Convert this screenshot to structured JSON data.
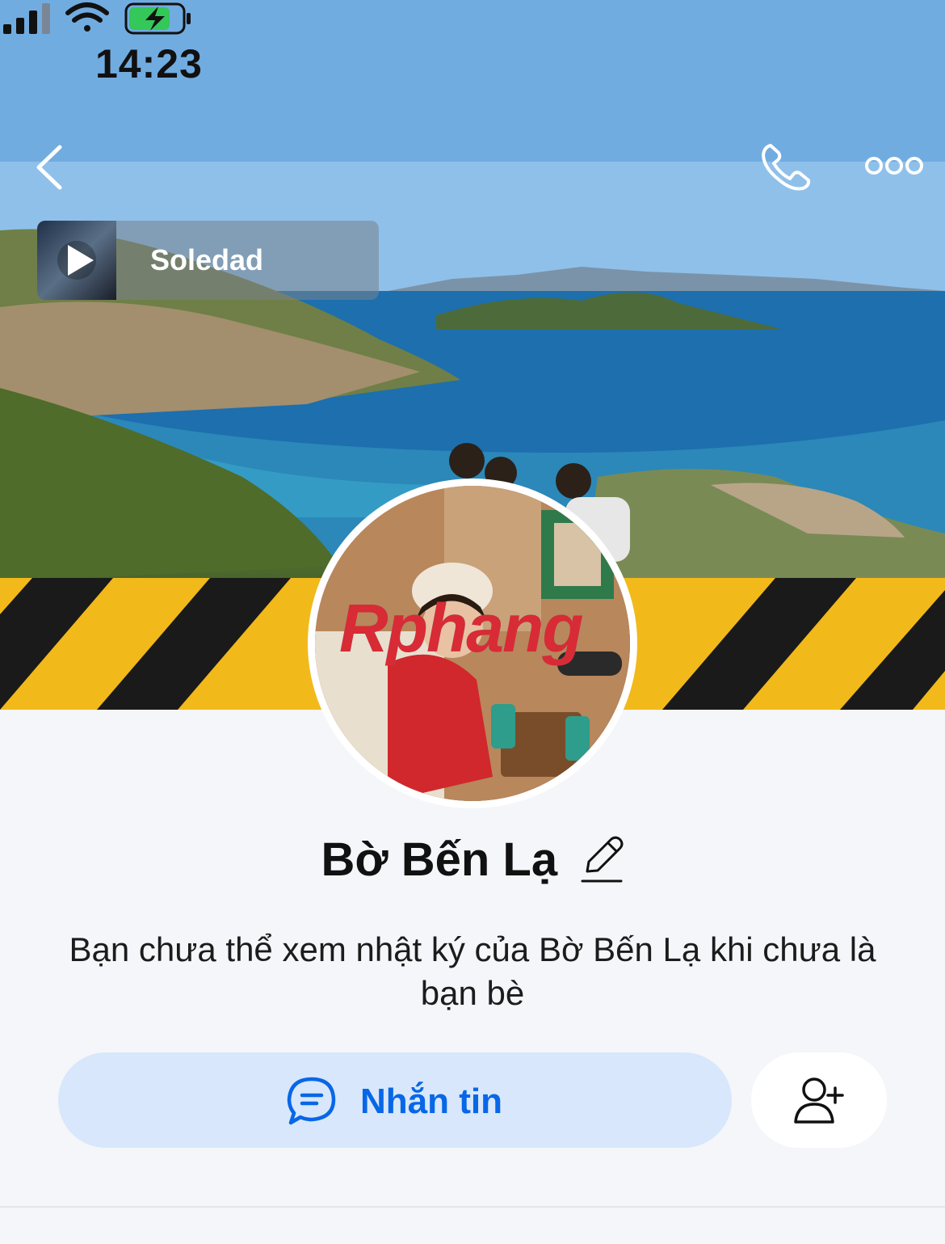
{
  "status_bar": {
    "time": "14:23"
  },
  "header": {
    "back_icon": "chevron-left-icon",
    "call_icon": "phone-icon",
    "more_icon": "more-horizontal-icon"
  },
  "music": {
    "title": "Soledad",
    "icon": "play-icon"
  },
  "profile": {
    "name": "Bờ Bến Lạ",
    "watermark": "Rphang",
    "notice": "Bạn chưa thể xem nhật ký của Bờ Bến Lạ khi chưa là bạn bè"
  },
  "actions": {
    "message_label": "Nhắn tin",
    "message_icon": "chat-bubble-icon",
    "add_friend_icon": "add-friend-icon"
  },
  "colors": {
    "accent": "#0867e6",
    "accent_bg": "#d8e7fb",
    "page_bg": "#f4f6f9"
  }
}
